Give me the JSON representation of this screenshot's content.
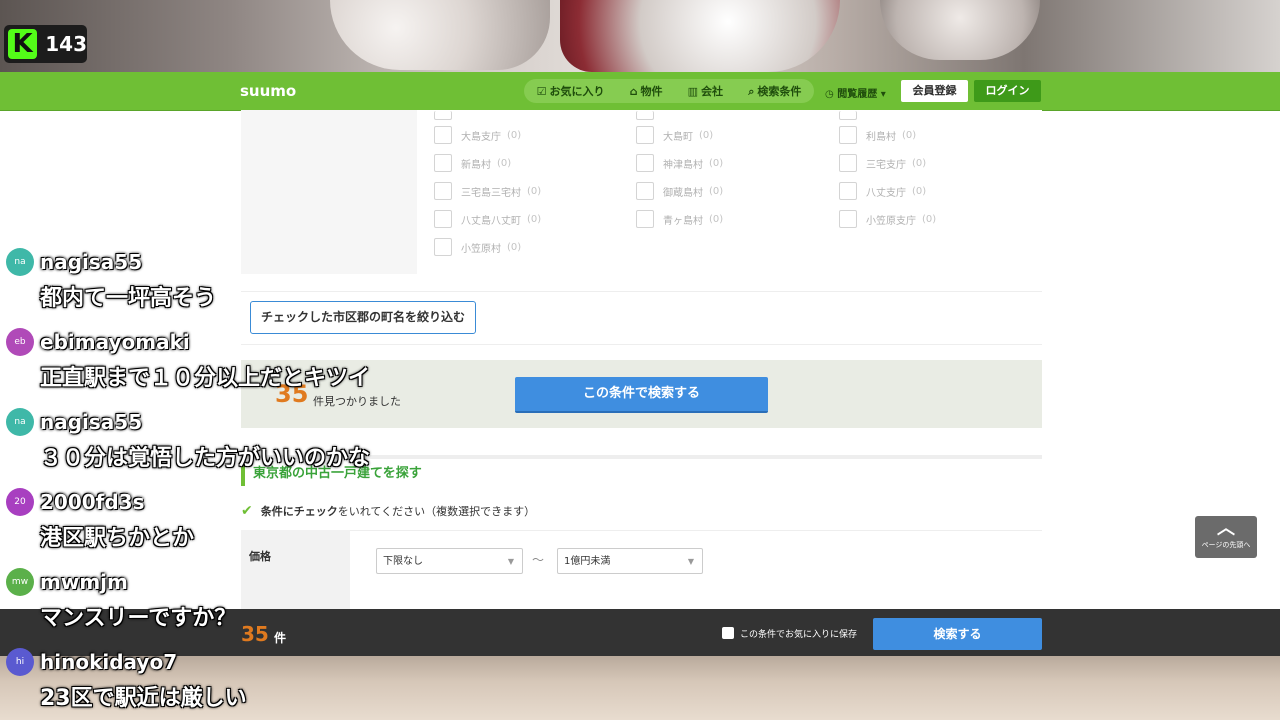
{
  "stream": {
    "viewer_count": "143",
    "platform_icon": "kick-logo"
  },
  "header": {
    "logo": "suumo",
    "nav": [
      {
        "icon": "check-box-icon",
        "label": "お気に入り"
      },
      {
        "icon": "house-icon",
        "label": "物件"
      },
      {
        "icon": "building-icon",
        "label": "会社"
      },
      {
        "icon": "search-icon",
        "label": "検索条件"
      }
    ],
    "history_label": "閲覧履歴",
    "register_label": "会員登録",
    "login_label": "ログイン"
  },
  "areas": [
    {
      "name": "大島支庁",
      "count": "(0)"
    },
    {
      "name": "大島町",
      "count": "(0)"
    },
    {
      "name": "利島村",
      "count": "(0)"
    },
    {
      "name": "新島村",
      "count": "(0)"
    },
    {
      "name": "神津島村",
      "count": "(0)"
    },
    {
      "name": "三宅支庁",
      "count": "(0)"
    },
    {
      "name": "三宅島三宅村",
      "count": "(0)"
    },
    {
      "name": "御蔵島村",
      "count": "(0)"
    },
    {
      "name": "八丈支庁",
      "count": "(0)"
    },
    {
      "name": "八丈島八丈町",
      "count": "(0)"
    },
    {
      "name": "青ヶ島村",
      "count": "(0)"
    },
    {
      "name": "小笠原支庁",
      "count": "(0)"
    },
    {
      "name": "小笠原村",
      "count": "(0)"
    }
  ],
  "filter_button": "チェックした市区郡の町名を絞り込む",
  "result": {
    "count": "35",
    "suffix": "件見つかりました",
    "search_button": "この条件で検索する"
  },
  "section": {
    "title": "東京都の中古一戸建てを探す",
    "note_bold": "条件にチェック",
    "note_rest": "をいれてください（複数選択できます）"
  },
  "price": {
    "label": "価格",
    "min": "下限なし",
    "tilde": "〜",
    "max": "1億円未満"
  },
  "scroll_top": {
    "label": "ページの先頭へ"
  },
  "bottom_bar": {
    "count": "35",
    "unit": "件",
    "save_label": "この条件でお気に入りに保存",
    "search_button": "検索する"
  },
  "chat": [
    {
      "abbr": "na",
      "user": "nagisa55",
      "text": "都内て一坪高そう",
      "color": "#3fb8a8"
    },
    {
      "abbr": "eb",
      "user": "ebimayomaki",
      "text": "正直駅まで１０分以上だとキツイ",
      "color": "#b04ab8"
    },
    {
      "abbr": "na",
      "user": "nagisa55",
      "text": "３０分は覚悟した方がいいのかな",
      "color": "#3fb8a8"
    },
    {
      "abbr": "20",
      "user": "2000fd3s",
      "text": "港区駅ちかとか",
      "color": "#a83fc0"
    },
    {
      "abbr": "mw",
      "user": "mwmjm",
      "text": "マンスリーですか？",
      "color": "#5bb04a"
    },
    {
      "abbr": "hi",
      "user": "hinokidayo7",
      "text": "23区で駅近は厳しい",
      "color": "#5a5ad0"
    }
  ]
}
